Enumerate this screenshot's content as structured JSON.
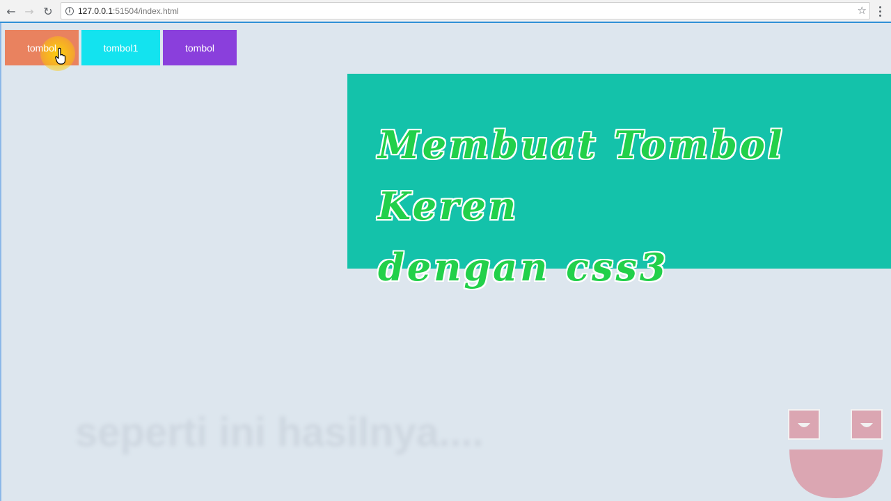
{
  "browser": {
    "url_host": "127.0.0.1",
    "url_rest": ":51504/index.html",
    "icons": {
      "back": "arrow-left-icon",
      "forward": "arrow-right-icon",
      "reload": "reload-icon",
      "info": "info-icon",
      "bookmark": "star-icon",
      "menu": "menu-dots-icon"
    }
  },
  "buttons": [
    {
      "label": "tombol",
      "color": "#e9825f"
    },
    {
      "label": "tombol1",
      "color": "#13e3ef"
    },
    {
      "label": "tombol",
      "color": "#8a3fdc"
    }
  ],
  "banner": {
    "line1": "Membuat Tombol Keren",
    "line2": "dengan css3",
    "background": "#14c2aa",
    "text_color": "#22d04a"
  },
  "overlay": {
    "caption": "seperti ini hasilnya...."
  }
}
